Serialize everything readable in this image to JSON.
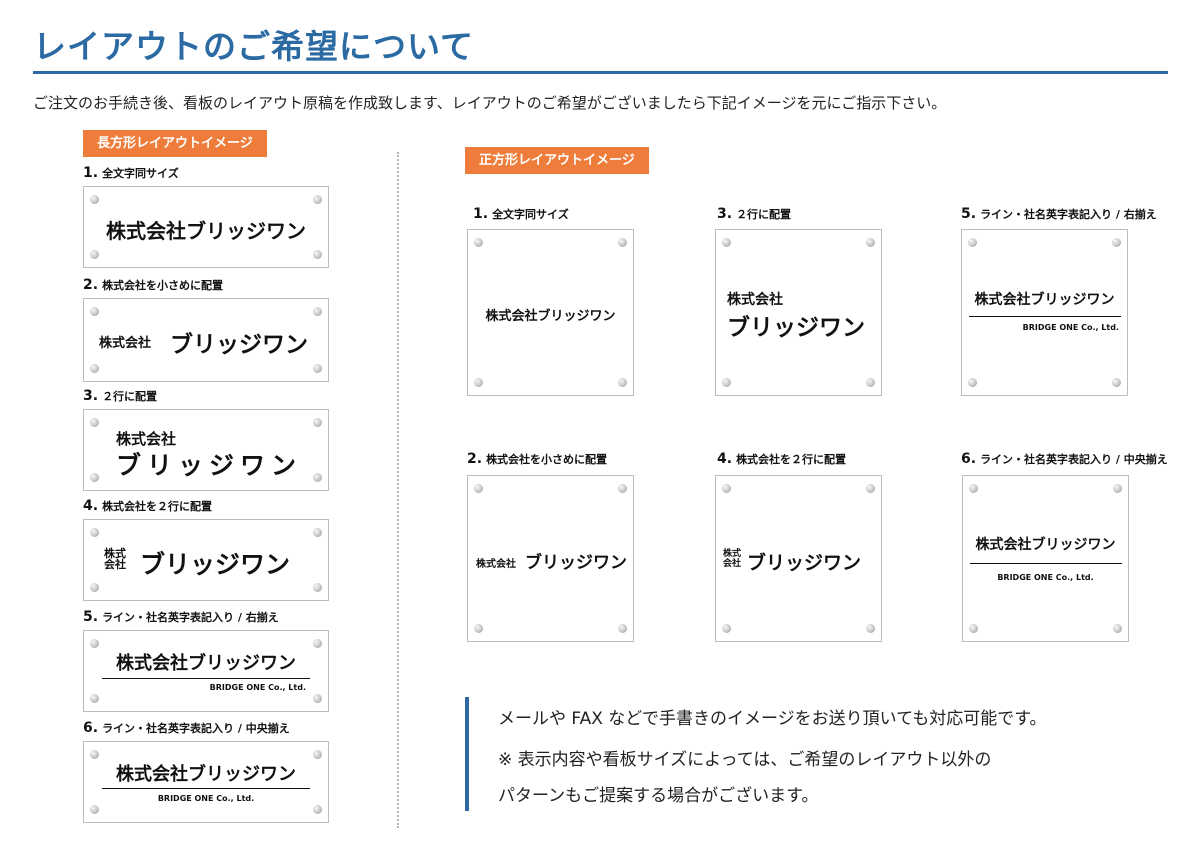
{
  "title": "レイアウトのご希望について",
  "intro": "ご注文のお手続き後、看板のレイアウト原稿を作成致します、レイアウトのご希望がございましたら下記イメージを元にご指示下さい。",
  "rect_section": {
    "tag": "長方形レイアウトイメージ",
    "items": [
      {
        "num": "1.",
        "label": "全文字同サイズ",
        "company": "株式会社ブリッジワン"
      },
      {
        "num": "2.",
        "label": "株式会社を小さめに配置",
        "prefix": "株式会社",
        "name": "ブリッジワン"
      },
      {
        "num": "3.",
        "label": "２行に配置",
        "prefix": "株式会社",
        "name": "ブリッジワン"
      },
      {
        "num": "4.",
        "label": "株式会社を２行に配置",
        "prefix_top": "株式",
        "prefix_bottom": "会社",
        "name": "ブリッジワン"
      },
      {
        "num": "5.",
        "label": "ライン・社名英字表記入り / 右揃え",
        "company": "株式会社ブリッジワン",
        "english": "BRIDGE ONE Co., Ltd."
      },
      {
        "num": "6.",
        "label": "ライン・社名英字表記入り / 中央揃え",
        "company": "株式会社ブリッジワン",
        "english": "BRIDGE ONE Co., Ltd."
      }
    ]
  },
  "square_section": {
    "tag": "正方形レイアウトイメージ",
    "items": [
      {
        "num": "1.",
        "label": "全文字同サイズ",
        "company": "株式会社ブリッジワン"
      },
      {
        "num": "3.",
        "label": "２行に配置",
        "prefix": "株式会社",
        "name": "ブリッジワン"
      },
      {
        "num": "5.",
        "label": "ライン・社名英字表記入り / 右揃え",
        "company": "株式会社ブリッジワン",
        "english": "BRIDGE ONE Co., Ltd."
      },
      {
        "num": "2.",
        "label": "株式会社を小さめに配置",
        "prefix": "株式会社",
        "name": "ブリッジワン"
      },
      {
        "num": "4.",
        "label": "株式会社を２行に配置",
        "prefix_top": "株式",
        "prefix_bottom": "会社",
        "name": "ブリッジワン"
      },
      {
        "num": "6.",
        "label": "ライン・社名英字表記入り / 中央揃え",
        "company": "株式会社ブリッジワン",
        "english": "BRIDGE ONE Co., Ltd."
      }
    ]
  },
  "notes": {
    "line1": "メールや FAX などで手書きのイメージをお送り頂いても対応可能です。",
    "line2": "※ 表示内容や看板サイズによっては、ご希望のレイアウト以外の",
    "line3": "パターンもご提案する場合がございます。"
  },
  "colors": {
    "accent_blue": "#2b6aa3",
    "tag_orange": "#ee7d3b"
  }
}
